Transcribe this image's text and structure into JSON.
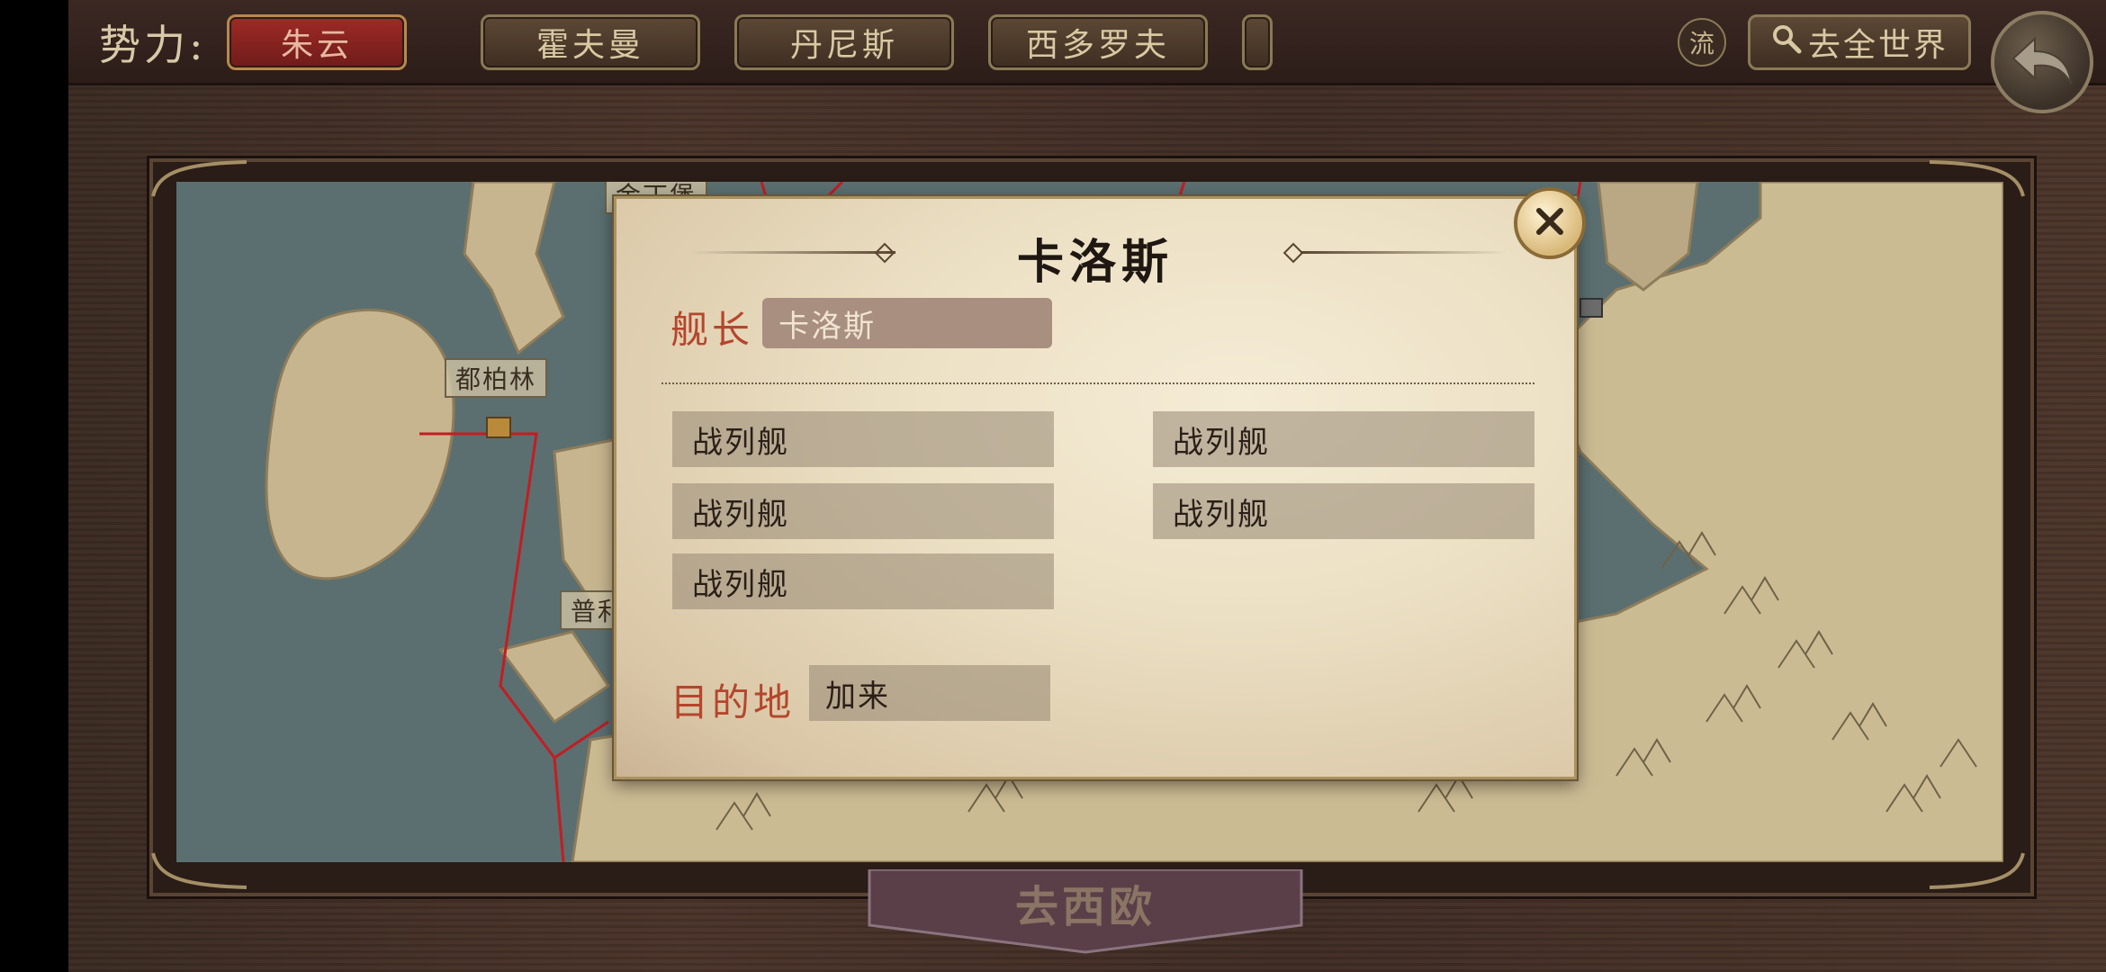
{
  "topbar": {
    "faction_label": "势力:",
    "factions": [
      "朱云",
      "霍夫曼",
      "丹尼斯",
      "西多罗夫"
    ],
    "active_faction": "朱云",
    "stream_label": "流",
    "world_button": "去全世界"
  },
  "map": {
    "cities": {
      "dublin": "都柏林",
      "partial_top": "金丁堡",
      "partial_mid": "普利"
    },
    "destination_tab": "去西欧"
  },
  "popup": {
    "title": "卡洛斯",
    "captain_label": "舰长",
    "captain_value": "卡洛斯",
    "ships": [
      "战列舰",
      "战列舰",
      "战列舰",
      "战列舰",
      "战列舰"
    ],
    "destination_label": "目的地",
    "destination_value": "加来"
  },
  "colors": {
    "accent_red": "#b4462c",
    "active_tab": "#9e2a26",
    "route_line": "#c21d22"
  }
}
